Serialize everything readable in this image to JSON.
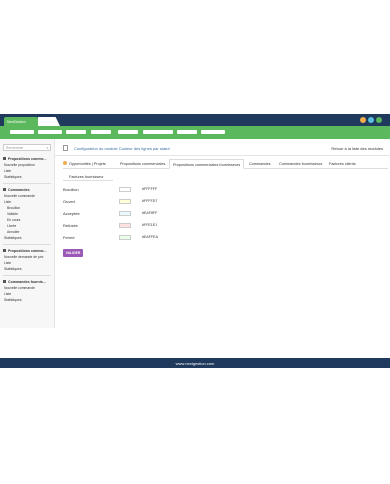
{
  "app": {
    "tab_label": "NextGestion"
  },
  "window_controls": {
    "colors": [
      "#f0ad4e",
      "#5bc0de",
      "#5cb85c"
    ]
  },
  "menu": {
    "item_count": 8
  },
  "sidebar": {
    "search_placeholder": "Rechercher",
    "sections": [
      {
        "title": "Propositions comme...",
        "items": [
          "Nouvelle proposition",
          "Liste",
          "Statistiques"
        ]
      },
      {
        "title": "Commandes",
        "items": [
          "Nouvelle commande",
          "Liste"
        ],
        "subitems": [
          "Brouillon",
          "Validée",
          "En cours",
          "Livrée",
          "Annulée"
        ],
        "after": [
          "Statistiques"
        ]
      },
      {
        "title": "Propositions comme...",
        "items": [
          "Nouvelle demande de prix",
          "Liste",
          "Statistiques"
        ]
      },
      {
        "title": "Commandes fournis...",
        "items": [
          "Nouvelle commande",
          "Liste",
          "Statistiques"
        ]
      }
    ]
  },
  "header": {
    "title": "Configuration du module Couleur des lignes par statut",
    "back_link": "Retour à la liste des modules"
  },
  "tabs": {
    "row1": [
      "Opportunités | Projets",
      "Propositions commerciales",
      "Propositions commerciales fournisseurs",
      "Commandes",
      "Commandes fournisseurs",
      "Factures clients"
    ],
    "row2": [
      "Factures fournisseur"
    ],
    "active_index": 2
  },
  "statuses": [
    {
      "label": "Brouillon",
      "hex": "#FFFFFF",
      "color": "#FFFFFF"
    },
    {
      "label": "Ouvert",
      "hex": "#FFFFD7",
      "color": "#FFFFD7"
    },
    {
      "label": "Acceptée",
      "hex": "#EAF8FF",
      "color": "#EAF8FF"
    },
    {
      "label": "Refusée",
      "hex": "#FFE1E1",
      "color": "#FFE1E1"
    },
    {
      "label": "Fermé",
      "hex": "#EAFFEA",
      "color": "#EAFFEA"
    }
  ],
  "actions": {
    "validate_label": "VALIDER"
  },
  "footer": {
    "text": "www.nextgestion.com"
  },
  "colors": {
    "topbar": "#1f3a5c",
    "accent_green": "#5cb85c",
    "button_purple": "#9b59b6",
    "link_blue": "#3a6ea5"
  }
}
